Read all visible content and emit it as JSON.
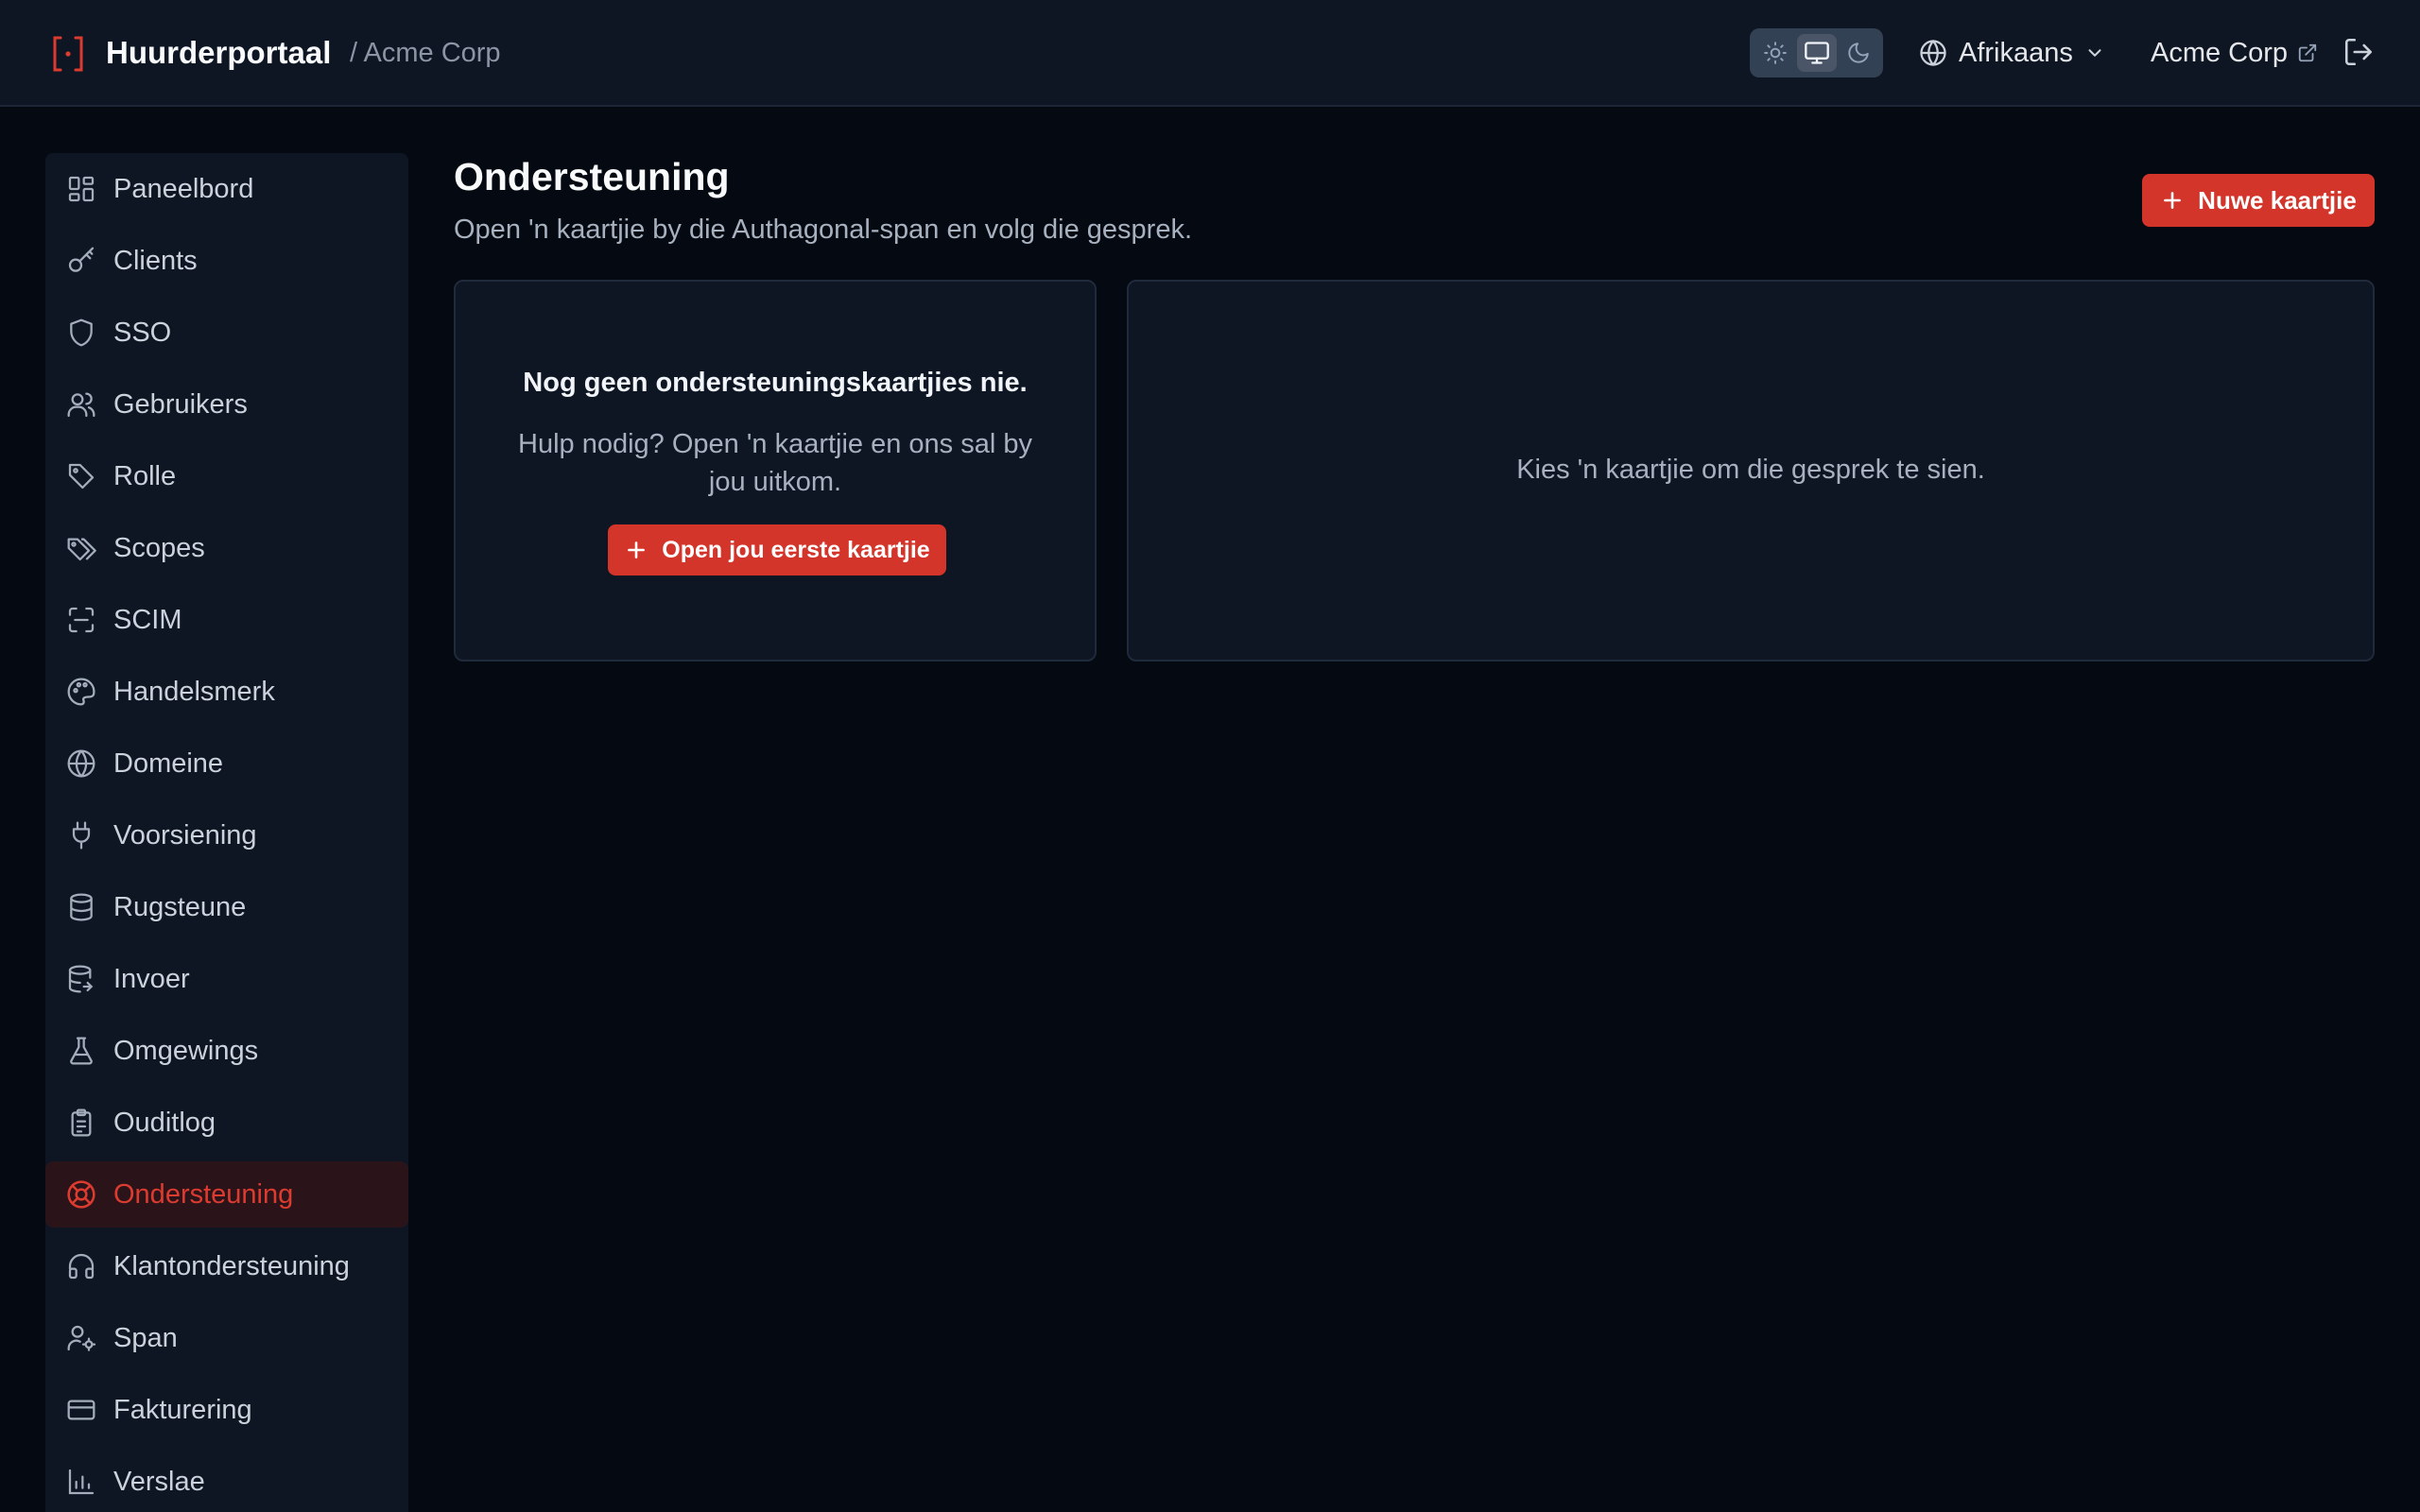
{
  "header": {
    "brand_title": "Huurderportaal",
    "breadcrumb": "/ Acme Corp",
    "theme_options": [
      "light",
      "system",
      "dark"
    ],
    "theme_selected": "system",
    "language": "Afrikaans",
    "org_name": "Acme Corp"
  },
  "sidebar": {
    "items": [
      {
        "label": "Paneelbord",
        "icon": "dashboard-icon"
      },
      {
        "label": "Clients",
        "icon": "key-icon"
      },
      {
        "label": "SSO",
        "icon": "shield-icon"
      },
      {
        "label": "Gebruikers",
        "icon": "users-icon"
      },
      {
        "label": "Rolle",
        "icon": "tag-icon"
      },
      {
        "label": "Scopes",
        "icon": "tags-icon"
      },
      {
        "label": "SCIM",
        "icon": "scan-icon"
      },
      {
        "label": "Handelsmerk",
        "icon": "palette-icon"
      },
      {
        "label": "Domeine",
        "icon": "globe-icon"
      },
      {
        "label": "Voorsiening",
        "icon": "plug-icon"
      },
      {
        "label": "Rugsteune",
        "icon": "database-icon"
      },
      {
        "label": "Invoer",
        "icon": "database-import-icon"
      },
      {
        "label": "Omgewings",
        "icon": "flask-icon"
      },
      {
        "label": "Ouditlog",
        "icon": "clipboard-icon"
      },
      {
        "label": "Ondersteuning",
        "icon": "lifebuoy-icon",
        "active": true
      },
      {
        "label": "Klantondersteuning",
        "icon": "headphones-icon"
      },
      {
        "label": "Span",
        "icon": "user-cog-icon"
      },
      {
        "label": "Fakturering",
        "icon": "credit-card-icon"
      },
      {
        "label": "Verslae",
        "icon": "bar-chart-icon"
      }
    ]
  },
  "main": {
    "title": "Ondersteuning",
    "subtitle": "Open 'n kaartjie by die Authagonal-span en volg die gesprek.",
    "new_ticket_label": "Nuwe kaartjie",
    "empty_title": "Nog geen ondersteuningskaartjies nie.",
    "empty_desc": "Hulp nodig? Open 'n kaartjie en ons sal by jou uitkom.",
    "first_ticket_label": "Open jou eerste kaartjie",
    "detail_hint": "Kies 'n kaartjie om die gesprek te sien."
  },
  "colors": {
    "accent": "#d3352b",
    "background": "#050a12",
    "panel": "#0e1623",
    "active_nav_bg": "#2a141a"
  }
}
